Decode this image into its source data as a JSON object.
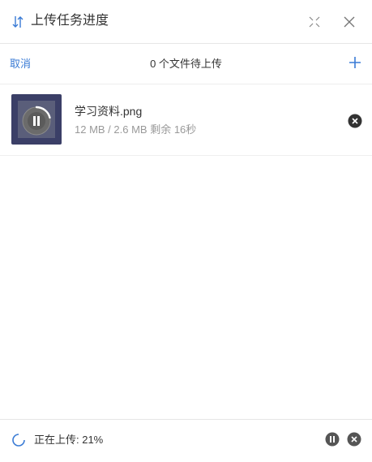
{
  "header": {
    "title": "上传任务进度",
    "title_icon": "upload-download-arrows-icon",
    "expand_icon": "expand-icon",
    "close_icon": "close-icon"
  },
  "toolbar": {
    "cancel_label": "取消",
    "status_text": "0 个文件待上传",
    "add_icon": "plus-icon"
  },
  "files": [
    {
      "name": "学习资料.png",
      "meta": "12 MB / 2.6 MB 剩余 16秒",
      "progress_fraction": 0.21,
      "state_icon": "pause-icon",
      "remove_icon": "remove-icon"
    }
  ],
  "footer": {
    "status": "正在上传: 21%",
    "spinner_icon": "spinner-icon",
    "pause_icon": "pause-all-icon",
    "cancel_icon": "cancel-all-icon"
  },
  "colors": {
    "accent": "#3a7bd5",
    "icon_gray": "#666666",
    "thumb_bg": "#3b3f67"
  }
}
